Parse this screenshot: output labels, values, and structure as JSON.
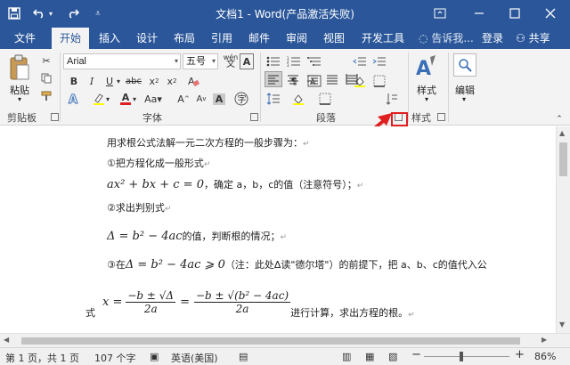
{
  "titlebar": {
    "title": "文档1 - Word(产品激活失败)",
    "save_icon": "save-icon",
    "undo_icon": "undo-icon",
    "redo_icon": "redo-icon"
  },
  "tabs": [
    {
      "label": "文件"
    },
    {
      "label": "开始"
    },
    {
      "label": "插入"
    },
    {
      "label": "设计"
    },
    {
      "label": "布局"
    },
    {
      "label": "引用"
    },
    {
      "label": "邮件"
    },
    {
      "label": "审阅"
    },
    {
      "label": "视图"
    },
    {
      "label": "开发工具"
    }
  ],
  "tell_me": "告诉我...",
  "sign_in": "登录",
  "share": "共享",
  "ribbon": {
    "clipboard": {
      "paste_label": "粘贴",
      "group_label": "剪贴板"
    },
    "font": {
      "font_name": "Arial",
      "font_size": "五号",
      "wen": "wén",
      "group_label": "字体"
    },
    "paragraph": {
      "group_label": "段落"
    },
    "styles": {
      "label": "样式",
      "group_label": "样式"
    },
    "editing": {
      "label": "编辑"
    }
  },
  "document": {
    "line1": "用求根公式法解一元二次方程的一般步骤为：",
    "line2": "①把方程化成一般形式",
    "line3_eq": "ax² + bx + c = 0",
    "line3_text": "，确定 a，b，c的值（注意符号）；",
    "line4": "②求出判别式",
    "line5_eq": "Δ = b² − 4ac",
    "line5_text": "的值，判断根的情况；",
    "line6_pre": "③在",
    "line6_eq": "Δ = b² − 4ac ⩾ 0",
    "line6_text": "（注：此处Δ读\"德尔塔\"）的前提下，把 a、b、c的值代入公",
    "line7_pre": "式",
    "line7_x": "x =",
    "line7_num1": "−b ± √Δ",
    "line7_den1": "2a",
    "line7_eq": "=",
    "line7_num2": "−b ± √(b² − 4ac)",
    "line7_den2": "2a",
    "line7_text": "进行计算，求出方程的根。",
    "para_mark": "↵"
  },
  "status": {
    "page": "第 1 页，共 1 页",
    "words": "107 个字",
    "lang": "英语(美国)",
    "zoom": "86%",
    "minus": "−",
    "plus": "+"
  }
}
